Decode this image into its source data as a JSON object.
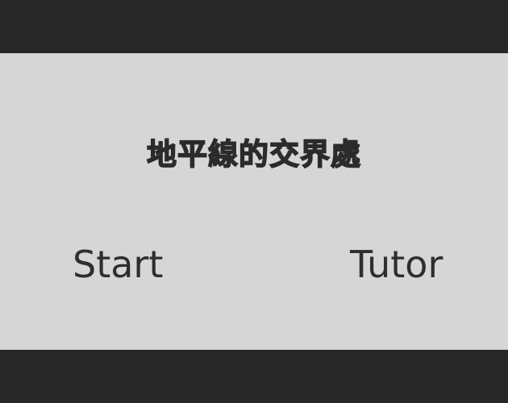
{
  "game": {
    "title": "地平線的交界處",
    "menu": {
      "start_label": "Start",
      "tutor_label": "Tutor"
    }
  },
  "colors": {
    "letterbox": "#272727",
    "stage_background": "#d6d6d6",
    "text": "#2e2e2e"
  }
}
